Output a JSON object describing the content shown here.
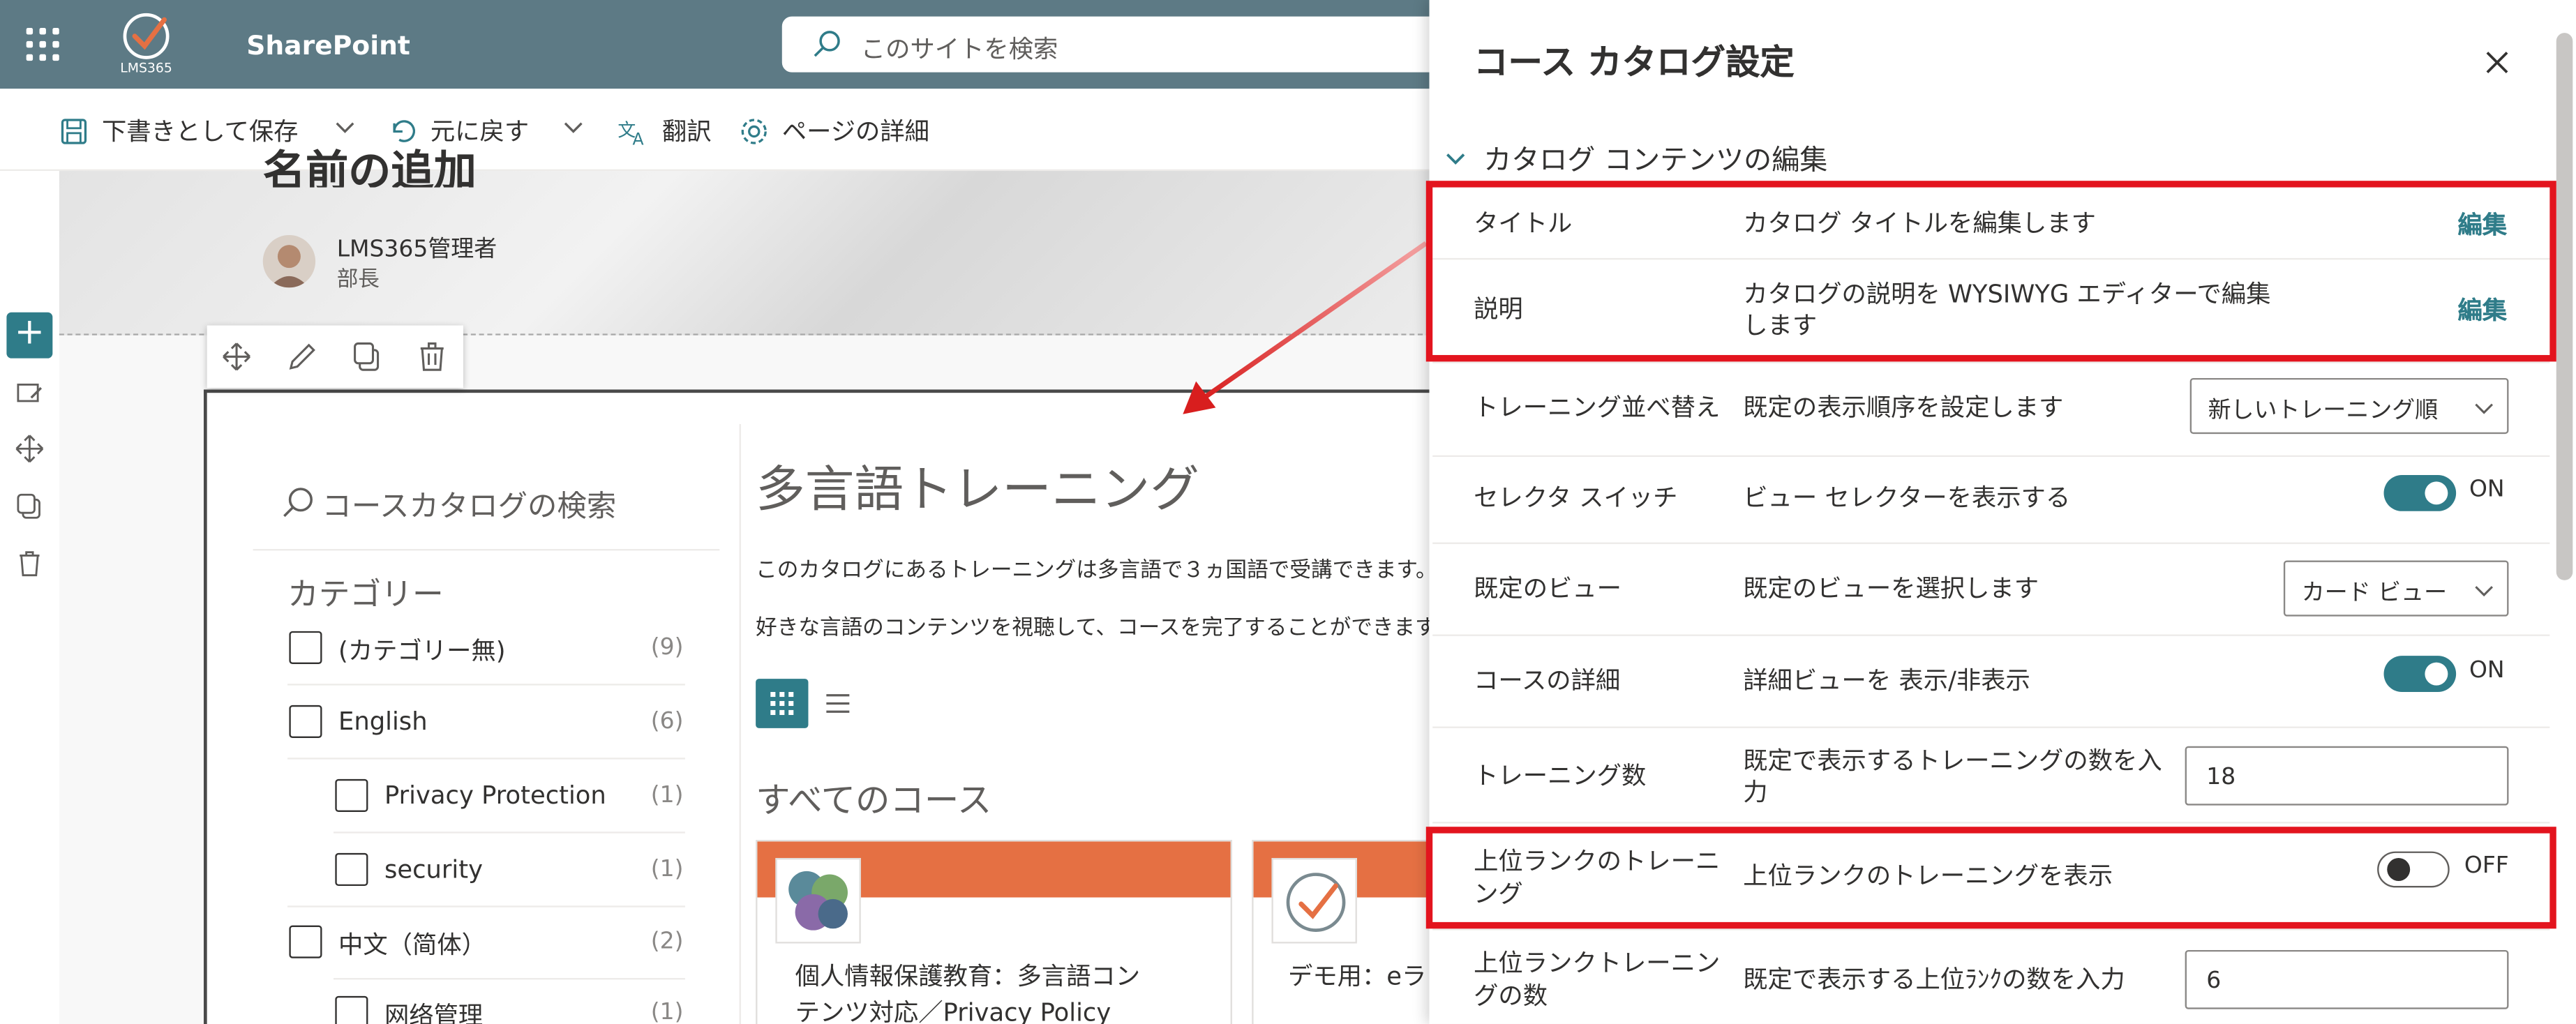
{
  "suite": {
    "logo_text": "LMS365",
    "brand": "SharePoint",
    "search_placeholder": "このサイトを検索"
  },
  "commands": {
    "save_draft": "下書きとして保存",
    "undo": "元に戻す",
    "translate": "翻訳",
    "page_details": "ページの詳細"
  },
  "page": {
    "title_partial": "名前の追加",
    "author": "LMS365管理者",
    "role": "部長"
  },
  "catalog": {
    "search_placeholder": "コースカタログの検索",
    "categories_heading": "カテゴリー",
    "categories": [
      {
        "label": "(カテゴリー無)",
        "count": "(9)"
      },
      {
        "label": "English",
        "count": "(6)"
      },
      {
        "label": "Privacy Protection",
        "count": "(1)"
      },
      {
        "label": "security",
        "count": "(1)"
      },
      {
        "label": "中文（简体）",
        "count": "(2)"
      },
      {
        "label": "网络管理",
        "count": "(1)"
      }
    ],
    "title": "多言語トレーニング",
    "description_1": "このカタログにあるトレーニングは多言語で３ヵ国語で受講できます。",
    "description_2": "好きな言語のコンテンツを視聴して、コースを完了することができます。",
    "all_courses": "すべてのコース",
    "cards": [
      {
        "title_line1": "個人情報保護教育：多言語コン",
        "title_line2": "テンツ対応／Privacy Policy"
      },
      {
        "title_line1": "デモ用：eラ"
      }
    ]
  },
  "panel": {
    "title": "コース カタログ設定",
    "section": "カタログ コンテンツの編集",
    "rows": {
      "title": {
        "label": "タイトル",
        "desc": "カタログ タイトルを編集します",
        "action": "編集"
      },
      "description": {
        "label": "説明",
        "desc_line1": "カタログの説明を WYSIWYG エディターで編集",
        "desc_line2": "します",
        "action": "編集"
      },
      "sort": {
        "label": "トレーニング並べ替え",
        "desc": "既定の表示順序を設定します",
        "value": "新しいトレーニング順"
      },
      "selector": {
        "label": "セレクタ スイッチ",
        "desc": "ビュー セレクターを表示する",
        "state": "ON"
      },
      "default_view": {
        "label": "既定のビュー",
        "desc": "既定のビューを選択します",
        "value": "カード ビュー"
      },
      "details": {
        "label": "コースの詳細",
        "desc": "詳細ビューを 表示/非表示",
        "state": "ON"
      },
      "count": {
        "label": "トレーニング数",
        "desc_line1": "既定で表示するトレーニングの数を入",
        "desc_line2": "力",
        "value": "18"
      },
      "top_ranked": {
        "label_line1": "上位ランクのトレーニ",
        "label_line2": "ング",
        "desc": "上位ランクのトレーニングを表示",
        "state": "OFF"
      },
      "top_ranked_count": {
        "label_line1": "上位ランクトレーニン",
        "label_line2": "グの数",
        "desc": "既定で表示する上位ﾗﾝｸの数を入力",
        "value": "6"
      }
    }
  },
  "colors": {
    "accent": "#2f7c89",
    "suite_bar": "#5d7a85",
    "highlight": "#e3141e",
    "card_header": "#e57043"
  }
}
